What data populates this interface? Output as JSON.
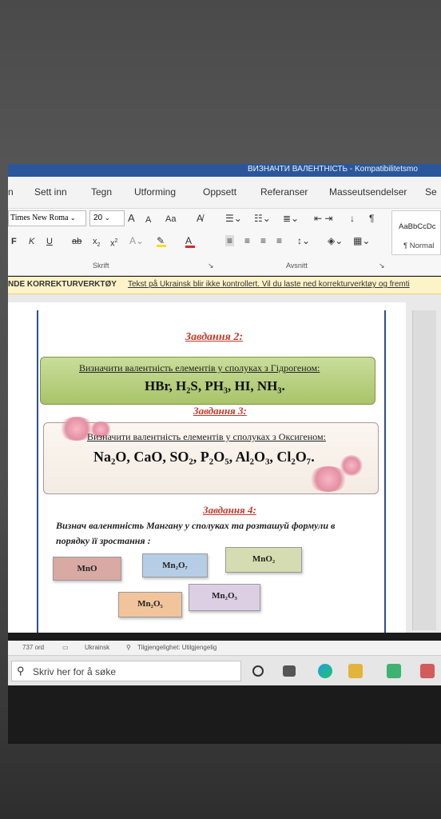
{
  "titlebar": {
    "title": "ВИЗНАЧТИ ВАЛЕНТНІСТЬ - Kompatibilitetsmo"
  },
  "menu": {
    "tabs": [
      "n",
      "Sett inn",
      "Tegn",
      "Utforming",
      "Oppsett",
      "Referanser",
      "Masseutsendelser",
      "Se"
    ]
  },
  "ribbon": {
    "font_name": "Times New Roma",
    "font_size": "20",
    "grow_font": "A",
    "shrink_font": "A",
    "change_case": "Aa",
    "bold": "F",
    "italic": "K",
    "underline": "U",
    "strikethrough": "ab",
    "subscript": "x",
    "superscript": "x",
    "group_font": "Skrift",
    "group_paragraph": "Avsnitt",
    "style_1": "AaBbCcDc",
    "style_2": "¶ Normal",
    "colors": {
      "highlight": "#f2e01b",
      "font_color": "#d62b2b"
    }
  },
  "messagebar": {
    "label": "NDE KORREKTURVERKTØY",
    "text": "Tekst på Ukrainsk blir ikke kontrollert. Vil du laste ned korrekturverktøy og fremti"
  },
  "document": {
    "task2": {
      "heading": "Завдання 2:",
      "instruction": "Визначити валентність елементів у сполуках з Гідрогеном:",
      "formulas": "HBr, H₂S, PH₃, HI, NH₃."
    },
    "task3": {
      "heading": "Завдання 3:",
      "instruction": "Визначити валентність елементів у сполуках з Оксигеном:",
      "formulas": "Na₂O, CaO, SO₂, P₂O₅, Al₂O₃, Cl₂O₇."
    },
    "task4": {
      "heading": "Завдання 4:",
      "instruction": "Визнач валентність Мангану у сполуках та розташуй формули в порядку її зростання :",
      "boxes": [
        {
          "label": "MnO",
          "color": "#d9a9a4"
        },
        {
          "label": "Mn₂O₇",
          "color": "#b6cde6"
        },
        {
          "label": "MnO₂",
          "color": "#d6dcb1"
        },
        {
          "label": "Mn₂O₅",
          "color": "#f2c49b"
        },
        {
          "label": "Mn₂O₃",
          "color": "#dccfe4"
        }
      ]
    }
  },
  "statusbar": {
    "words": "737 ord",
    "language": "Ukrainsk",
    "accessibility": "Tilgjengelighet: Utilgjengelig"
  },
  "taskbar": {
    "search_placeholder": "Skriv her for å søke"
  }
}
